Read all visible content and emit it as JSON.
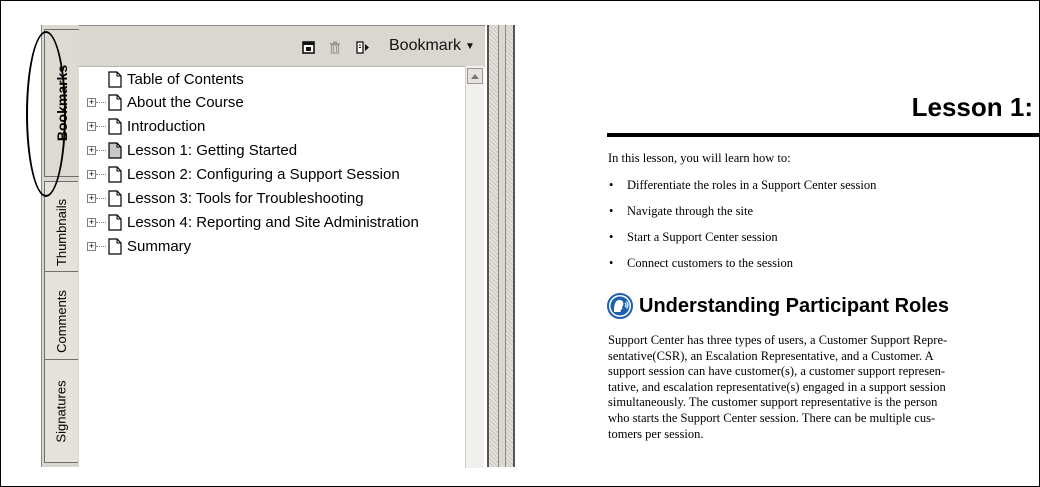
{
  "tabs": [
    {
      "label": "Bookmarks",
      "active": true
    },
    {
      "label": "Thumbnails",
      "active": false
    },
    {
      "label": "Comments",
      "active": false
    },
    {
      "label": "Signatures",
      "active": false
    }
  ],
  "toolbar": {
    "new_bookmark_icon": "new-bookmark-icon",
    "delete_icon": "trash-icon",
    "expand_icon": "expand-bookmark-icon",
    "menu_label": "Bookmark",
    "menu_arrow": "▼"
  },
  "bookmarks": [
    {
      "label": "Table of Contents",
      "expandable": false
    },
    {
      "label": "About the Course",
      "expandable": true
    },
    {
      "label": "Introduction",
      "expandable": true
    },
    {
      "label": "Lesson 1: Getting Started",
      "expandable": true,
      "selected": true
    },
    {
      "label": "Lesson 2: Configuring a Support Session",
      "expandable": true
    },
    {
      "label": "Lesson 3: Tools for Troubleshooting",
      "expandable": true
    },
    {
      "label": "Lesson 4: Reporting and Site Administration",
      "expandable": true
    },
    {
      "label": "Summary",
      "expandable": true
    }
  ],
  "document": {
    "title": "Lesson 1:",
    "intro": "In this lesson, you will learn how to:",
    "bullets": [
      "Differentiate the roles in a Support Center session",
      "Navigate through the site",
      "Start a Support Center session",
      "Connect customers to the session"
    ],
    "section_title": "Understanding Participant Roles",
    "section_icon": "speaking-head-icon",
    "paragraph_lines": [
      "Support Center has three types of users, a Customer Support Repre-",
      "sentative(CSR), an Escalation Representative, and a Customer. A",
      "support session can have customer(s), a customer support represen-",
      "tative, and escalation representative(s) engaged in a support session",
      "simultaneously. The customer support representative is the person",
      "who starts the Support Center session. There can be multiple cus-",
      "tomers per session."
    ]
  },
  "colors": {
    "panel": "#d9d7cf",
    "section_icon_blue": "#1d5fb0"
  }
}
